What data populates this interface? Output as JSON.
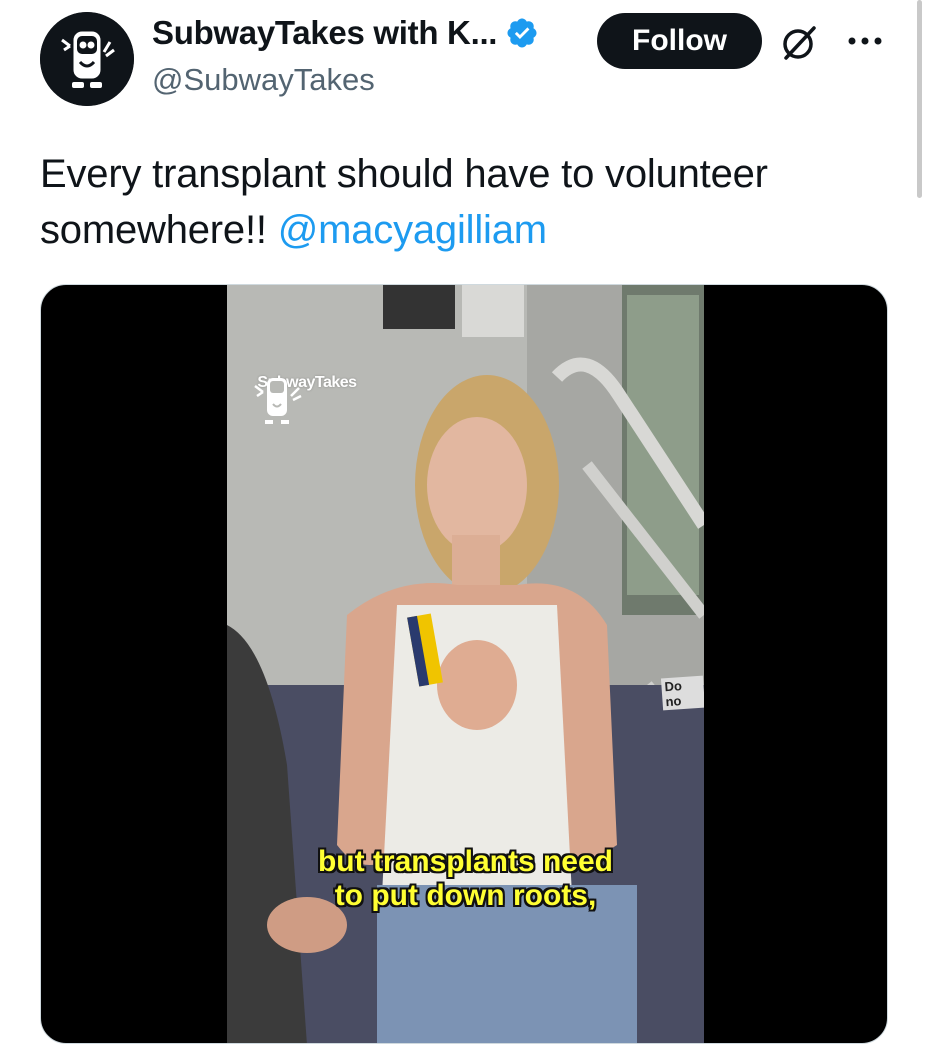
{
  "author": {
    "display_name": "SubwayTakes with K...",
    "handle": "@SubwayTakes",
    "verified_icon": "verified-badge-icon",
    "avatar_icon": "subwaytakes-mascot-icon"
  },
  "actions": {
    "follow_label": "Follow",
    "grok_icon": "grok-icon",
    "more_icon": "more-options-icon"
  },
  "tweet": {
    "text_before": "Every transplant should have to volunteer somewhere!! ",
    "mention": "@macyagilliam"
  },
  "media": {
    "watermark": "SubwayTakes",
    "sign_text": "Do no",
    "caption_line1": "but transplants need",
    "caption_line2": "to put down roots,"
  },
  "colors": {
    "accent": "#1d9bf0",
    "text": "#0f1419",
    "secondary": "#536471",
    "caption": "#ffff33"
  }
}
